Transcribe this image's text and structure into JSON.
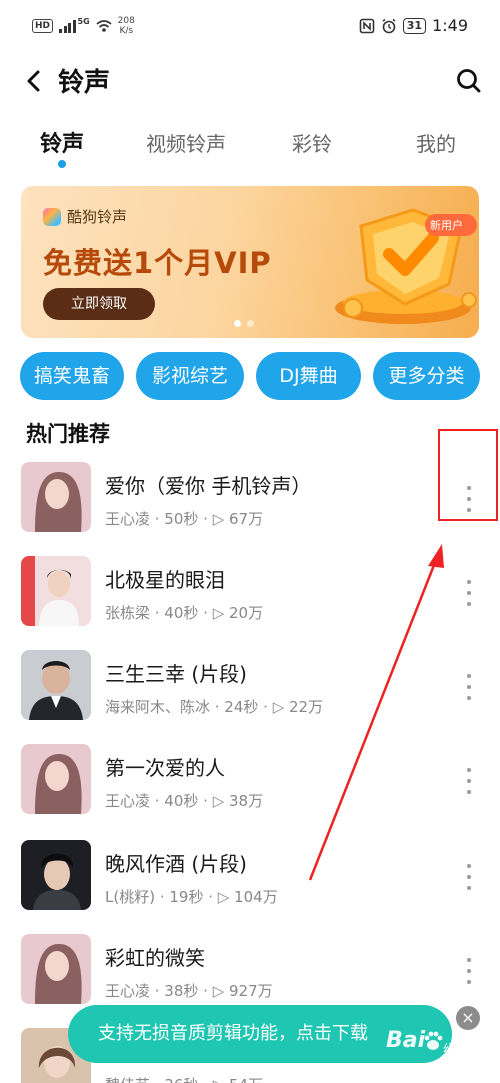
{
  "status_bar": {
    "hd": "HD",
    "network": "5G",
    "speed_value": "208",
    "speed_unit": "K/s",
    "battery": "31",
    "time": "1:49"
  },
  "header": {
    "title": "铃声",
    "back_icon": "chevron-left-icon",
    "search_icon": "search-icon"
  },
  "tabs": [
    {
      "label": "铃声",
      "active": true
    },
    {
      "label": "视频铃声",
      "active": false
    },
    {
      "label": "彩铃",
      "active": false
    },
    {
      "label": "我的",
      "active": false
    }
  ],
  "banner": {
    "brand": "酷狗铃声",
    "title": "免费送1个月VIP",
    "button": "立即领取",
    "tag": "新用户",
    "pages": 2,
    "current_page": 1
  },
  "categories": [
    "搞笑鬼畜",
    "影视综艺",
    "DJ舞曲",
    "更多分类"
  ],
  "section_title": "热门推荐",
  "songs": [
    {
      "title": "爱你（爱你 手机铃声）",
      "meta": "王心凌 · 50秒 · ▷ 67万"
    },
    {
      "title": "北极星的眼泪",
      "meta": "张栋梁 · 40秒 · ▷ 20万"
    },
    {
      "title": "三生三幸 (片段)",
      "meta": "海来阿木、陈冰 · 24秒 · ▷ 22万"
    },
    {
      "title": "第一次爱的人",
      "meta": "王心凌 · 40秒 · ▷ 38万"
    },
    {
      "title": "晚风作酒 (片段)",
      "meta": "L(桃籽) · 19秒 · ▷ 104万"
    },
    {
      "title": "彩虹的微笑",
      "meta": "王心凌 · 38秒 · ▷ 927万"
    },
    {
      "title": "",
      "meta": "魏佳艺 · 36秒 · ▷ 54万"
    }
  ],
  "toast": {
    "text": "支持无损音质剪辑功能，点击下载",
    "close": "×"
  },
  "watermark": {
    "logo": "Bai",
    "sub": "经验"
  },
  "colors": {
    "accent": "#20a4ea",
    "toast": "#1fc6b2",
    "annotation": "#ee2222"
  }
}
